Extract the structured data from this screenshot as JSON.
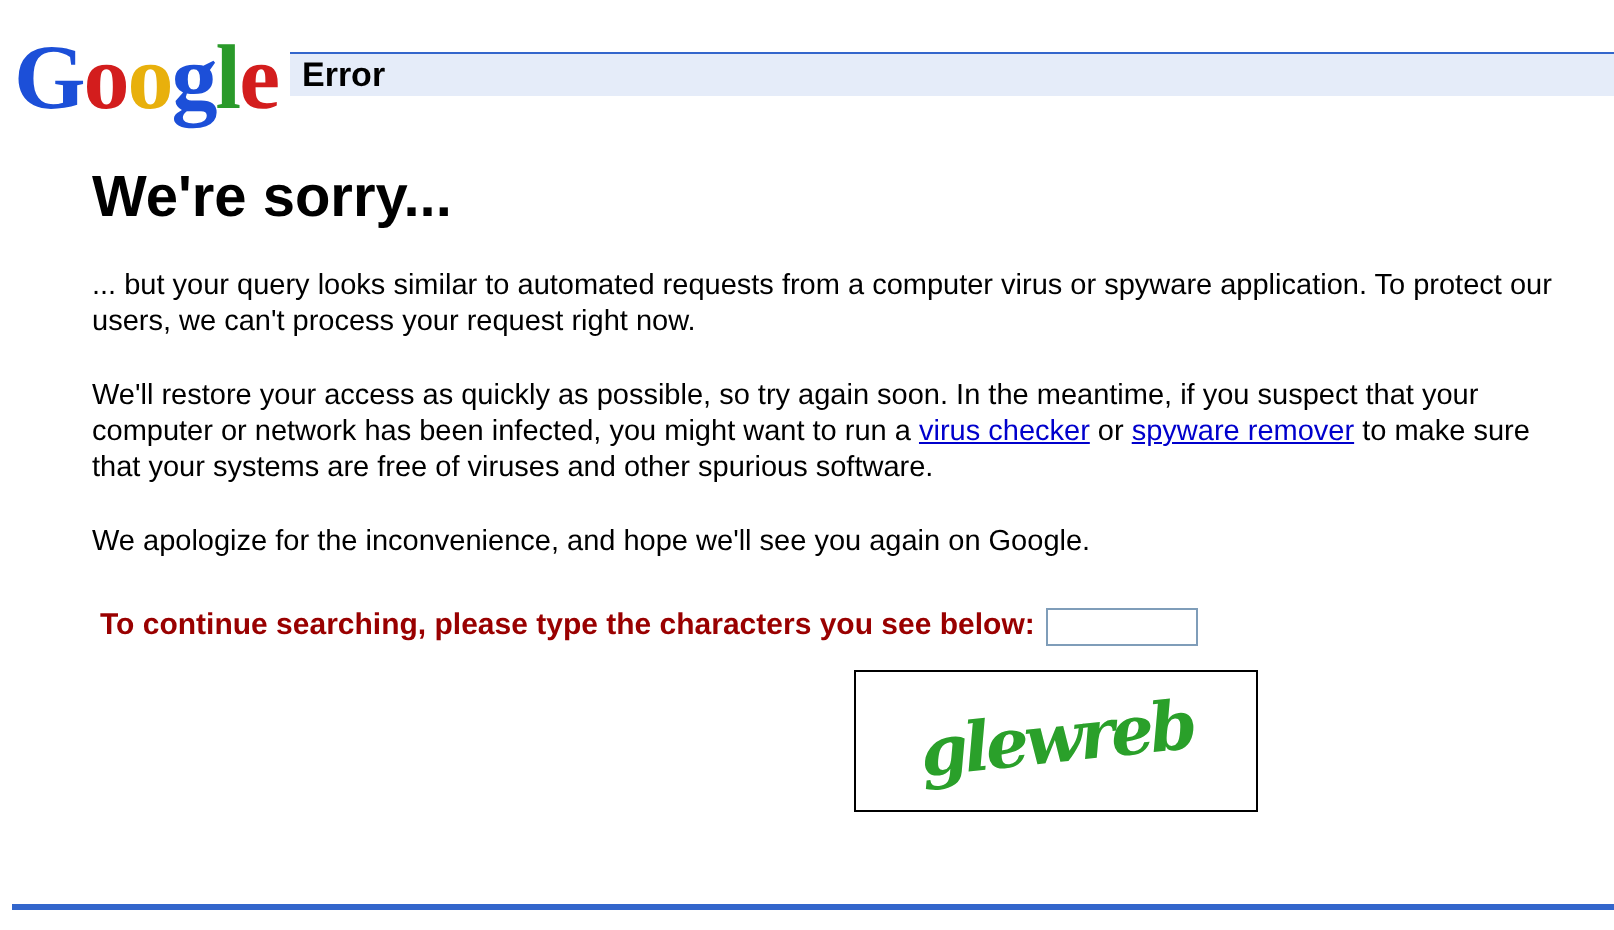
{
  "logo": [
    {
      "letter": "G",
      "color": "#1c4fd8"
    },
    {
      "letter": "o",
      "color": "#d31d1d"
    },
    {
      "letter": "o",
      "color": "#e8b00c"
    },
    {
      "letter": "g",
      "color": "#1c4fd8"
    },
    {
      "letter": "l",
      "color": "#2a9a2a"
    },
    {
      "letter": "e",
      "color": "#d31d1d"
    }
  ],
  "header": {
    "title": "Error"
  },
  "heading": "We're sorry...",
  "paragraphs": [
    {
      "parts": [
        {
          "text": "... but your query looks similar to automated requests from a computer virus or spyware application. To protect our users, we can't process your request right now."
        }
      ]
    },
    {
      "parts": [
        {
          "text": "We'll restore your access as quickly as possible, so try again soon. In the meantime, if you suspect that your computer or network has been infected, you might want to run a "
        },
        {
          "text": "virus checker",
          "kind": "link"
        },
        {
          "text": " or "
        },
        {
          "text": "spyware remover",
          "kind": "link"
        },
        {
          "text": " to make sure that your systems are free of viruses and other spurious software."
        }
      ]
    },
    {
      "parts": [
        {
          "text": "We apologize for the inconvenience, and hope we'll see you again on Google."
        }
      ]
    }
  ],
  "prompt": "To continue searching, please type the characters you see below:",
  "captcha": "glewreb"
}
